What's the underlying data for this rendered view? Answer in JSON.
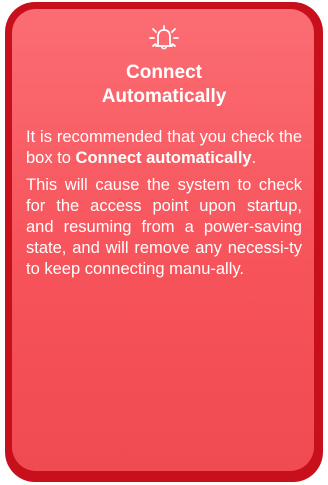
{
  "callout": {
    "icon": "bell-ringing-icon",
    "title_line1": "Connect",
    "title_line2": "Automatically",
    "para1_prefix": "It is recommended that you check the box to ",
    "para1_bold": "Connect automatically",
    "para1_suffix": ".",
    "para2": "This will cause the system to check for the access point upon startup, and resuming from a power-saving state, and will remove any necessi-ty to keep connecting manu-ally."
  },
  "colors": {
    "border": "#c8101c",
    "fill": "#f7535b",
    "text": "#ffffff"
  }
}
